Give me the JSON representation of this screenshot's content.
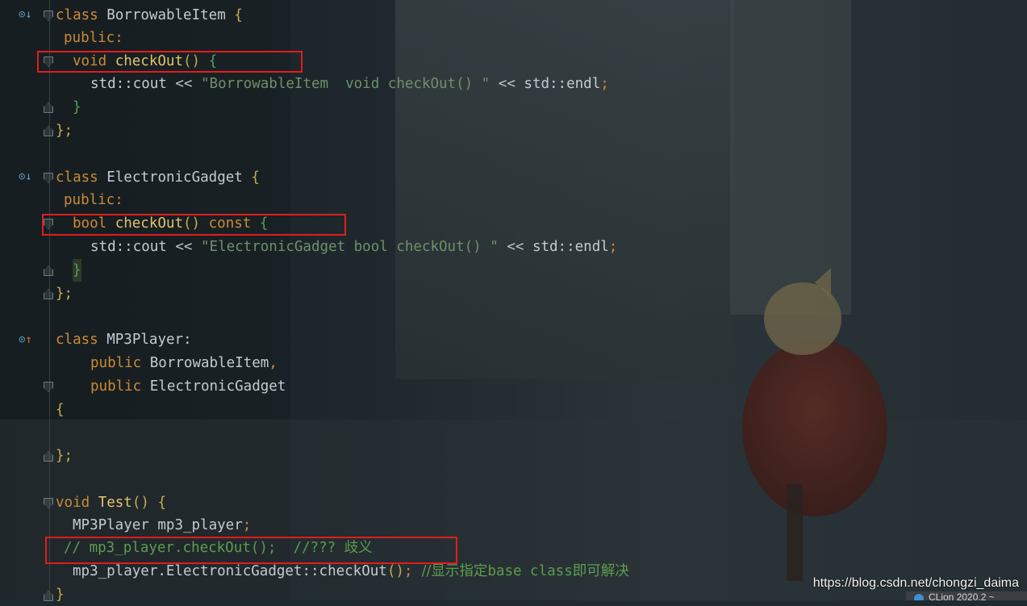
{
  "editor": {
    "lines": {
      "l1": {
        "kw": "class",
        "name": "BorrowableItem",
        "brace": "{"
      },
      "l2": {
        "text": "public:"
      },
      "l3": {
        "kw": "void",
        "fn": "checkOut",
        "paren": "()",
        "brace": "{"
      },
      "l4": {
        "ns": "std::cout",
        "op": "<<",
        "str": "\"BorrowableItem  void checkOut() \"",
        "op2": "<<",
        "ns2": "std::endl",
        "semi": ";"
      },
      "l5": {
        "brace": "}"
      },
      "l6": {
        "brace": "};"
      },
      "l7": {
        "kw": "class",
        "name": "ElectronicGadget",
        "brace": "{"
      },
      "l8": {
        "text": "public:"
      },
      "l9": {
        "kw": "bool",
        "fn": "checkOut",
        "paren": "()",
        "kw2": "const",
        "brace": "{"
      },
      "l10": {
        "ns": "std::cout",
        "op": "<<",
        "str": "\"ElectronicGadget bool checkOut() \"",
        "op2": "<<",
        "ns2": "std::endl",
        "semi": ";"
      },
      "l11": {
        "brace": "}"
      },
      "l12": {
        "brace": "};"
      },
      "l13": {
        "kw": "class",
        "name": "MP3Player:"
      },
      "l14": {
        "kw": "public",
        "name": "BorrowableItem",
        "comma": ","
      },
      "l15": {
        "kw": "public",
        "name": "ElectronicGadget"
      },
      "l16": {
        "brace": "{"
      },
      "l17": {
        "brace": "};"
      },
      "l18": {
        "kw": "void",
        "fn": "Test",
        "paren": "()",
        "brace": "{"
      },
      "l19": {
        "type": "MP3Player",
        "var": "mp3_player",
        "semi": ";"
      },
      "l20": {
        "comment": "// mp3_player.checkOut();  //??? ",
        "comment_zh": "歧义"
      },
      "l21": {
        "code": "mp3_player.ElectronicGadget::checkOut",
        "paren": "()",
        "semi": ";",
        "comment": "  //显示指定",
        "comment2": "base class",
        "comment3": "即可解决"
      },
      "l22": {
        "brace": "}"
      }
    }
  },
  "watermark": "https://blog.csdn.net/chongzi_daima",
  "status_bar": {
    "text": "CLion 2020.2 ~"
  },
  "colors": {
    "highlight_box": "#e31c1c",
    "keyword": "#cc8a35",
    "function": "#e3c26b",
    "comment": "#5c9d4d"
  }
}
